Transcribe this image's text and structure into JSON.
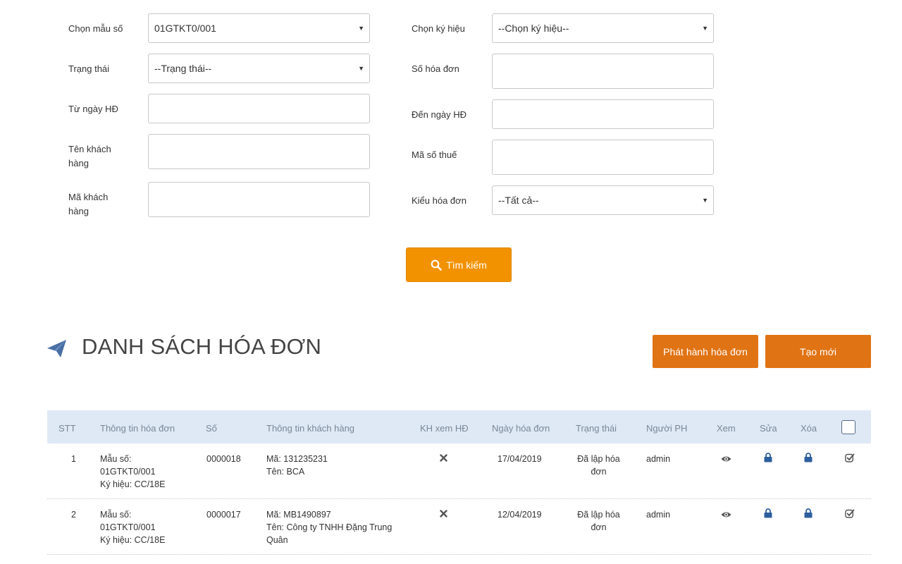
{
  "filters": {
    "mau_so": {
      "label": "Chọn mẫu số",
      "value": "01GTKT0/001"
    },
    "ky_hieu": {
      "label": "Chọn ký hiệu",
      "value": "--Chọn ký hiệu--"
    },
    "trang_thai": {
      "label": "Trạng thái",
      "value": "--Trạng thái--"
    },
    "so_hoa_don": {
      "label": "Số hóa đơn",
      "value": ""
    },
    "tu_ngay": {
      "label": "Từ ngày HĐ",
      "value": ""
    },
    "den_ngay": {
      "label": "Đến ngày HĐ",
      "value": ""
    },
    "ten_kh_line1": "Tên khách",
    "ten_kh_line2": "hàng",
    "ten_kh_value": "",
    "ma_so_thue": {
      "label": "Mã số thuế",
      "value": ""
    },
    "ma_kh_line1": "Mã khách",
    "ma_kh_line2": "hàng",
    "ma_kh_value": "",
    "kieu_hoa_don": {
      "label": "Kiểu hóa đơn",
      "value": "--Tất cả--"
    },
    "search_label": "Tìm kiếm"
  },
  "section": {
    "title": "DANH SÁCH HÓA ĐƠN",
    "publish_label": "Phát hành hóa đơn",
    "create_label": "Tạo mới"
  },
  "table": {
    "headers": {
      "stt": "STT",
      "info": "Thông tin hóa đơn",
      "so": "Số",
      "customer": "Thông tin khách hàng",
      "kh_xem": "KH xem HĐ",
      "ngay": "Ngày hóa đơn",
      "trang_thai": "Trạng thái",
      "nguoi_ph": "Người PH",
      "xem": "Xem",
      "sua": "Sửa",
      "xoa": "Xóa"
    },
    "rows": [
      {
        "stt": "1",
        "mau_so_label": "Mẫu số:",
        "mau_so": "01GTKT0/001",
        "ky_hieu": "Ký hiệu: CC/18E",
        "so": "0000018",
        "ma": "Mã: 131235231",
        "ten": "Tên: BCA",
        "ten2": "",
        "ngay": "17/04/2019",
        "trang_thai_1": "Đã lập hóa",
        "trang_thai_2": "đơn",
        "nguoi_ph": "admin"
      },
      {
        "stt": "2",
        "mau_so_label": "Mẫu số:",
        "mau_so": "01GTKT0/001",
        "ky_hieu": "Ký hiệu: CC/18E",
        "so": "0000017",
        "ma": "Mã: MB1490897",
        "ten": "Tên: Công ty TNHH Đặng Trung",
        "ten2": "Quân",
        "ngay": "12/04/2019",
        "trang_thai_1": "Đã lập hóa",
        "trang_thai_2": "đơn",
        "nguoi_ph": "admin"
      }
    ]
  },
  "icons": {
    "search": "search-icon",
    "title": "paper-plane-icon",
    "kh_xem": "close-icon",
    "xem": "eye-icon",
    "sua": "lock-icon",
    "xoa": "lock-icon",
    "approve": "check-square-icon",
    "caret": "caret-down-icon"
  },
  "colors": {
    "accent": "#f39200",
    "button": "#e07314",
    "header_bg": "#dfe9f6",
    "icon_blue": "#2d5f9e"
  }
}
